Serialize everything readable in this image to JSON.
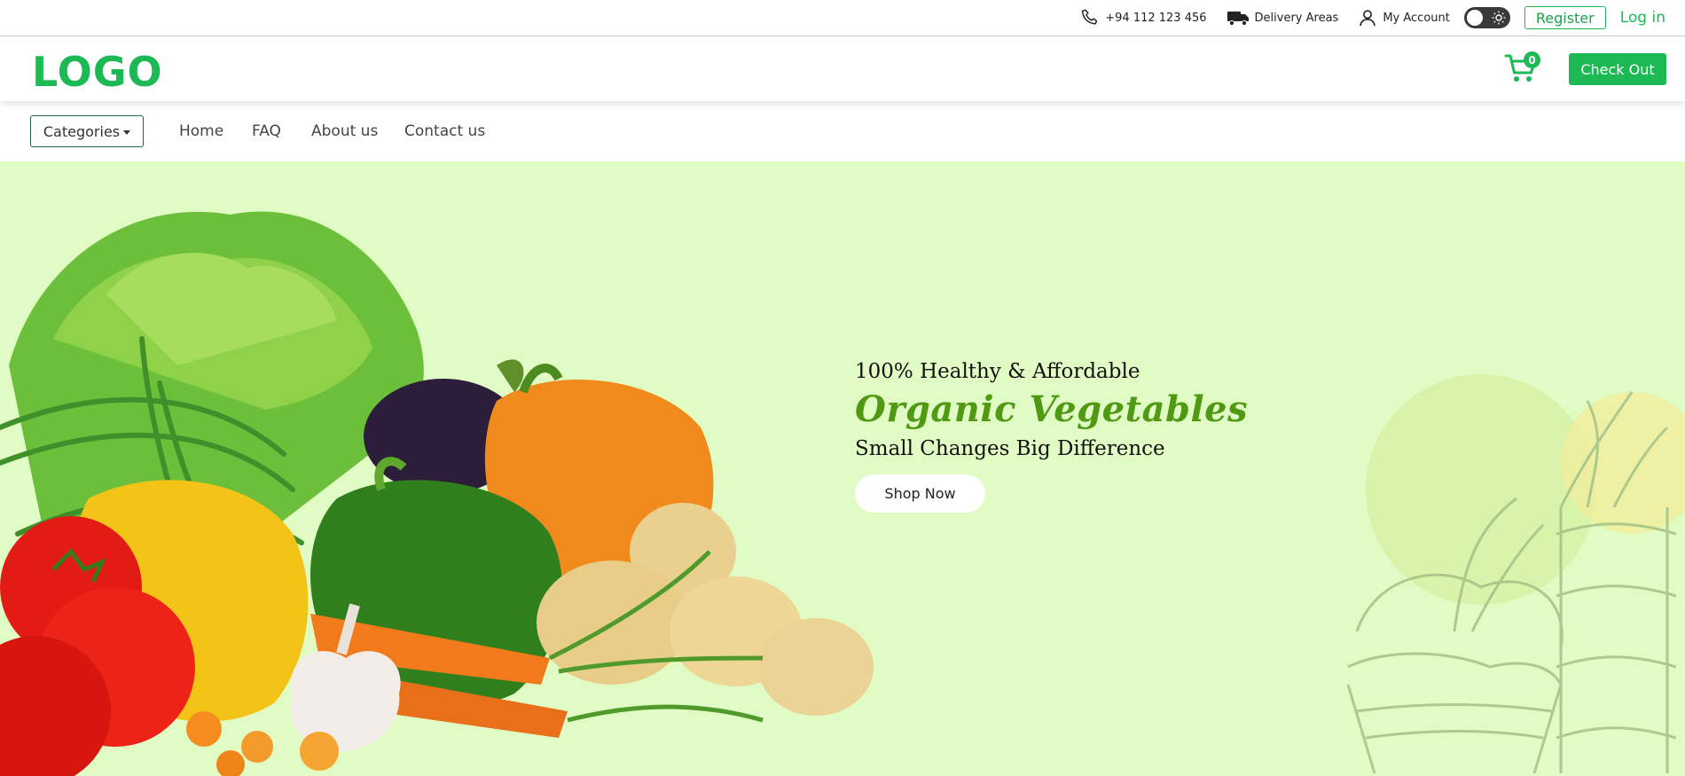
{
  "topbar": {
    "phone": "+94 112 123 456",
    "delivery": "Delivery Areas",
    "account": "My Account",
    "register": "Register",
    "login": "Log in"
  },
  "header": {
    "logo": "LOGO",
    "cart_count": "0",
    "checkout": "Check Out"
  },
  "nav": {
    "categories": "Categories",
    "links": [
      "Home",
      "FAQ",
      "About us",
      "Contact us"
    ]
  },
  "hero": {
    "tagline": "100% Healthy & Affordable",
    "headline": "Organic Vegetables",
    "subline": "Small Changes Big Difference",
    "cta": "Shop Now"
  },
  "colors": {
    "brand_green": "#1db954",
    "hero_bg": "#e1fbc4",
    "headline_green": "#4f9a12"
  },
  "icons": [
    "phone-icon",
    "truck-icon",
    "user-icon",
    "theme-toggle",
    "cart-icon"
  ]
}
